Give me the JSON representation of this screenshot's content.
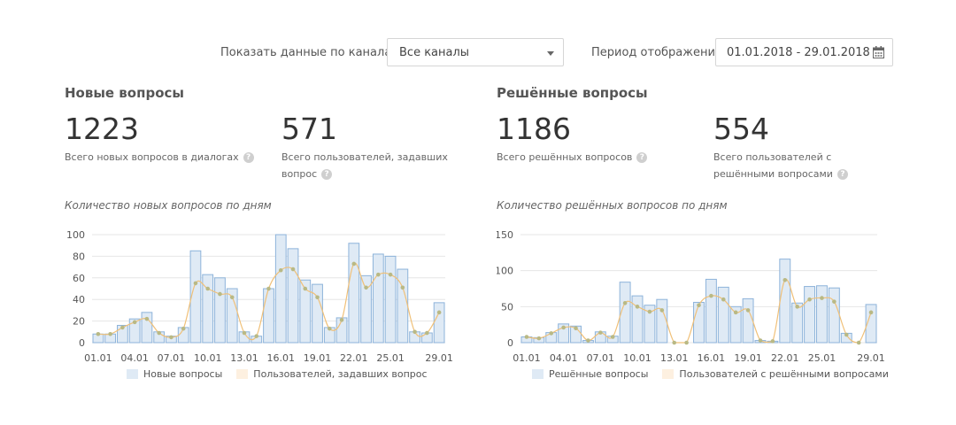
{
  "filters": {
    "channels_label": "Показать данные по каналам",
    "channels_value": "Все каналы",
    "period_label": "Период отображения",
    "period_value": "01.01.2018 - 29.01.2018"
  },
  "panels": [
    {
      "title": "Новые вопросы",
      "stat1": {
        "value": "1223",
        "desc": "Всего новых вопросов в диалогах"
      },
      "stat2": {
        "value": "571",
        "desc": "Всего пользователей, задавших вопрос"
      },
      "chart_title": "Количество новых вопросов по дням"
    },
    {
      "title": "Решённые вопросы",
      "stat1": {
        "value": "1186",
        "desc": "Всего решённых вопросов"
      },
      "stat2": {
        "value": "554",
        "desc": "Всего пользователей с решёнными вопросами"
      },
      "chart_title": "Количество решённых вопросов по дням"
    }
  ],
  "icons": {
    "help": "help-icon",
    "calendar": "calendar-icon",
    "dropdown": "chevron-down-icon"
  },
  "colors": {
    "bar_fill": "#dfeaf5",
    "bar_stroke": "#8db3da",
    "line": "#f0c078",
    "dot": "#b9b985",
    "legend_line": "#fdf0e0"
  },
  "chart_data": [
    {
      "type": "bar",
      "categories": [
        "01.01",
        "02.01",
        "03.01",
        "04.01",
        "05.01",
        "06.01",
        "07.01",
        "08.01",
        "09.01",
        "10.01",
        "11.01",
        "12.01",
        "13.01",
        "14.01",
        "15.01",
        "16.01",
        "17.01",
        "18.01",
        "19.01",
        "20.01",
        "21.01",
        "22.01",
        "23.01",
        "24.01",
        "25.01",
        "26.01",
        "27.01",
        "28.01",
        "29.01"
      ],
      "tick_labels": [
        "01.01",
        "04.01",
        "07.01",
        "10.01",
        "13.01",
        "16.01",
        "19.01",
        "22.01",
        "25.01",
        "29.01"
      ],
      "series": [
        {
          "name": "Новые вопросы",
          "kind": "bar",
          "values": [
            8,
            8,
            16,
            22,
            28,
            10,
            6,
            14,
            85,
            63,
            60,
            50,
            10,
            6,
            50,
            100,
            87,
            58,
            54,
            14,
            23,
            92,
            62,
            82,
            80,
            68,
            10,
            9,
            37
          ]
        },
        {
          "name": "Пользователей, задавших вопрос",
          "kind": "line",
          "values": [
            8,
            8,
            14,
            19,
            22,
            9,
            5,
            13,
            55,
            50,
            45,
            42,
            9,
            6,
            50,
            67,
            68,
            50,
            42,
            13,
            21,
            73,
            51,
            63,
            63,
            51,
            10,
            9,
            28
          ]
        }
      ],
      "ylim": [
        0,
        100
      ],
      "yticks": [
        0,
        20,
        40,
        60,
        80,
        100
      ]
    },
    {
      "type": "bar",
      "categories": [
        "01.01",
        "02.01",
        "03.01",
        "04.01",
        "05.01",
        "06.01",
        "07.01",
        "08.01",
        "09.01",
        "10.01",
        "11.01",
        "12.01",
        "13.01",
        "14.01",
        "15.01",
        "16.01",
        "17.01",
        "18.01",
        "19.01",
        "20.01",
        "21.01",
        "22.01",
        "23.01",
        "24.01",
        "25.01",
        "26.01",
        "27.01",
        "28.01",
        "29.01"
      ],
      "tick_labels": [
        "01.01",
        "04.01",
        "07.01",
        "10.01",
        "13.01",
        "16.01",
        "19.01",
        "22.01",
        "25.01",
        "29.01"
      ],
      "series": [
        {
          "name": "Решённые вопросы",
          "kind": "bar",
          "values": [
            8,
            7,
            14,
            26,
            23,
            3,
            15,
            9,
            84,
            65,
            52,
            60,
            0,
            0,
            56,
            88,
            77,
            50,
            61,
            3,
            2,
            116,
            55,
            78,
            79,
            76,
            13,
            0,
            53
          ]
        },
        {
          "name": "Пользователей с решёнными вопросами",
          "kind": "line",
          "values": [
            8,
            6,
            13,
            21,
            20,
            3,
            14,
            8,
            55,
            50,
            43,
            45,
            0,
            0,
            52,
            65,
            60,
            42,
            45,
            3,
            2,
            87,
            50,
            60,
            62,
            57,
            11,
            0,
            42
          ]
        }
      ],
      "ylim": [
        0,
        150
      ],
      "yticks": [
        0,
        50,
        100,
        150
      ]
    }
  ]
}
